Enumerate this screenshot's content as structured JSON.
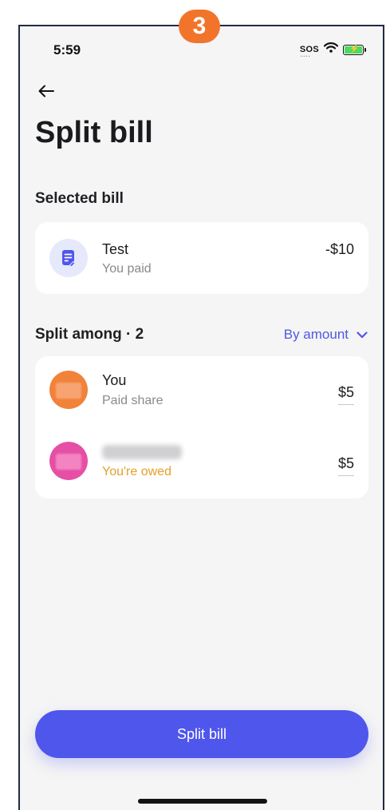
{
  "step_badge": "3",
  "status_bar": {
    "time": "5:59",
    "sos": "SOS",
    "wifi_icon": "wifi-icon",
    "battery_icon": "battery-charging-icon",
    "battery_color": "#4cd964"
  },
  "header": {
    "back_icon": "arrow-left-icon",
    "title": "Split bill"
  },
  "selected_bill": {
    "section_label": "Selected bill",
    "icon": "receipt-icon",
    "name": "Test",
    "subtitle": "You paid",
    "amount": "-$10"
  },
  "split": {
    "section_label": "Split among · 2",
    "mode_label": "By amount",
    "mode_icon": "chevron-down-icon",
    "members": [
      {
        "name": "You",
        "subtitle": "Paid share",
        "amount": "$5",
        "avatar_color": "#f0823a"
      },
      {
        "name": "",
        "subtitle": "You're owed",
        "amount": "$5",
        "avatar_color": "#e64fa6"
      }
    ]
  },
  "primary_button": {
    "label": "Split bill"
  },
  "colors": {
    "accent": "#4f56ec",
    "badge": "#f2742b",
    "owed": "#e3a02a",
    "background": "#f5f5f5"
  }
}
